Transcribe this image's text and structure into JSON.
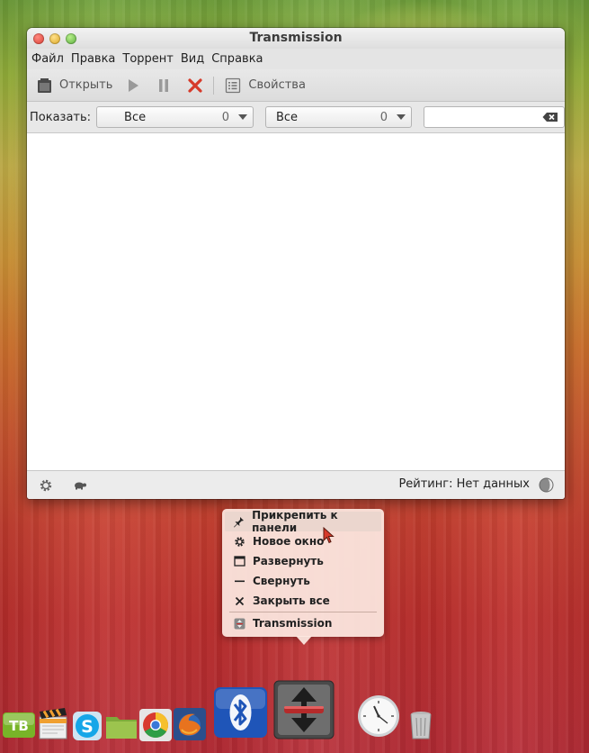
{
  "window": {
    "title": "Transmission",
    "menu": [
      "Файл",
      "Правка",
      "Торрент",
      "Вид",
      "Справка"
    ],
    "toolbar": {
      "open_label": "Открыть",
      "properties_label": "Свойства"
    },
    "filter": {
      "show_label": "Показать:",
      "combo1": {
        "value": "Все",
        "count": "0"
      },
      "combo2": {
        "value": "Все",
        "count": "0"
      },
      "search_placeholder": ""
    },
    "status": {
      "ratio_label": "Рейтинг: Нет данных"
    }
  },
  "context_menu": {
    "items": [
      {
        "label": "Прикрепить к панели",
        "icon": "pin-icon",
        "highlighted": true
      },
      {
        "label": "Новое окно",
        "icon": "gear-icon",
        "highlighted": false
      },
      {
        "label": "Развернуть",
        "icon": "maximize-icon",
        "highlighted": false
      },
      {
        "label": "Свернуть",
        "icon": "minimize-icon",
        "highlighted": false
      },
      {
        "label": "Закрыть все",
        "icon": "close-icon",
        "highlighted": false
      },
      {
        "label": "Transmission",
        "icon": "transmission-icon",
        "highlighted": false
      }
    ]
  },
  "dock": {
    "items": [
      "ТВ",
      "clapper",
      "skype",
      "folder",
      "chrome",
      "firefox",
      "bluetooth",
      "transmission",
      "clock",
      "trash"
    ]
  }
}
